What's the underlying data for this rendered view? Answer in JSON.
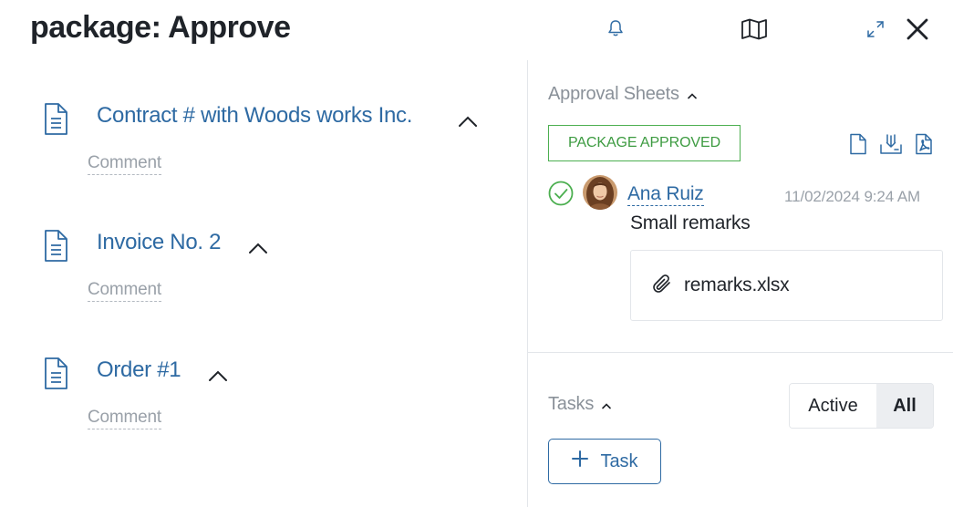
{
  "header": {
    "title": "package: Approve",
    "icons": [
      "bell-icon",
      "map-icon",
      "expand-icon",
      "close-icon"
    ]
  },
  "documents": [
    {
      "name": "Contract # with Woods works Inc.",
      "comment_label": "Comment",
      "icon": "document-icon",
      "expanded": true
    },
    {
      "name": "Invoice No. 2",
      "comment_label": "Comment",
      "icon": "document-icon",
      "expanded": true
    },
    {
      "name": "Order #1",
      "comment_label": "Comment",
      "icon": "document-icon",
      "expanded": true
    }
  ],
  "approval_sheets": {
    "title": "Approval Sheets",
    "status_badge": "PACKAGE APPROVED",
    "actions": [
      "file-icon",
      "download-icon",
      "pdf-icon"
    ],
    "entries": [
      {
        "user": "Ana Ruiz",
        "timestamp": "11/02/2024 9:24 AM",
        "comment": "Small remarks",
        "attachment": "remarks.xlsx",
        "status": "approved"
      }
    ]
  },
  "tasks": {
    "title": "Tasks",
    "filter_options": [
      "Active",
      "All"
    ],
    "selected_filter": "All",
    "add_button_label": "Task"
  },
  "colors": {
    "link": "#2e6aa3",
    "approved": "#4caf50",
    "muted": "#9aa1a9",
    "divider": "#e3e6ea",
    "selected_toggle_bg": "#eceef1"
  }
}
